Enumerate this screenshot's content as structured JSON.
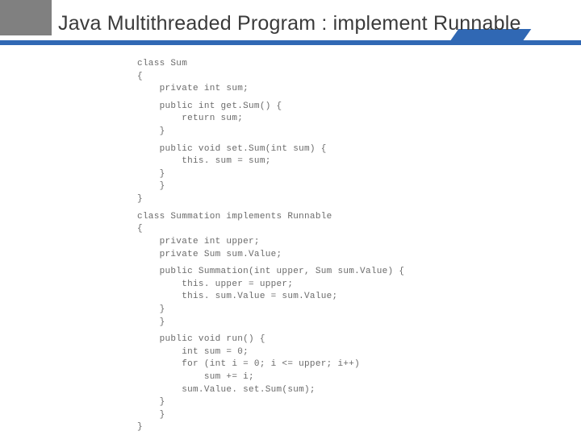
{
  "title": "Java Multithreaded Program : implement Runnable",
  "code": {
    "lines": [
      "class Sum",
      "{",
      "    private int sum;",
      "",
      "    public int get.Sum() {",
      "        return sum;",
      "    }",
      "",
      "    public void set.Sum(int sum) {",
      "        this. sum = sum;",
      "    }",
      "    }",
      "}",
      "",
      "class Summation implements Runnable",
      "{",
      "    private int upper;",
      "    private Sum sum.Value;",
      "",
      "    public Summation(int upper, Sum sum.Value) {",
      "        this. upper = upper;",
      "        this. sum.Value = sum.Value;",
      "    }",
      "    }",
      "",
      "    public void run() {",
      "        int sum = 0;",
      "        for (int i = 0; i <= upper; i++)",
      "            sum += i;",
      "        sum.Value. set.Sum(sum);",
      "    }",
      "    }",
      "}"
    ]
  }
}
